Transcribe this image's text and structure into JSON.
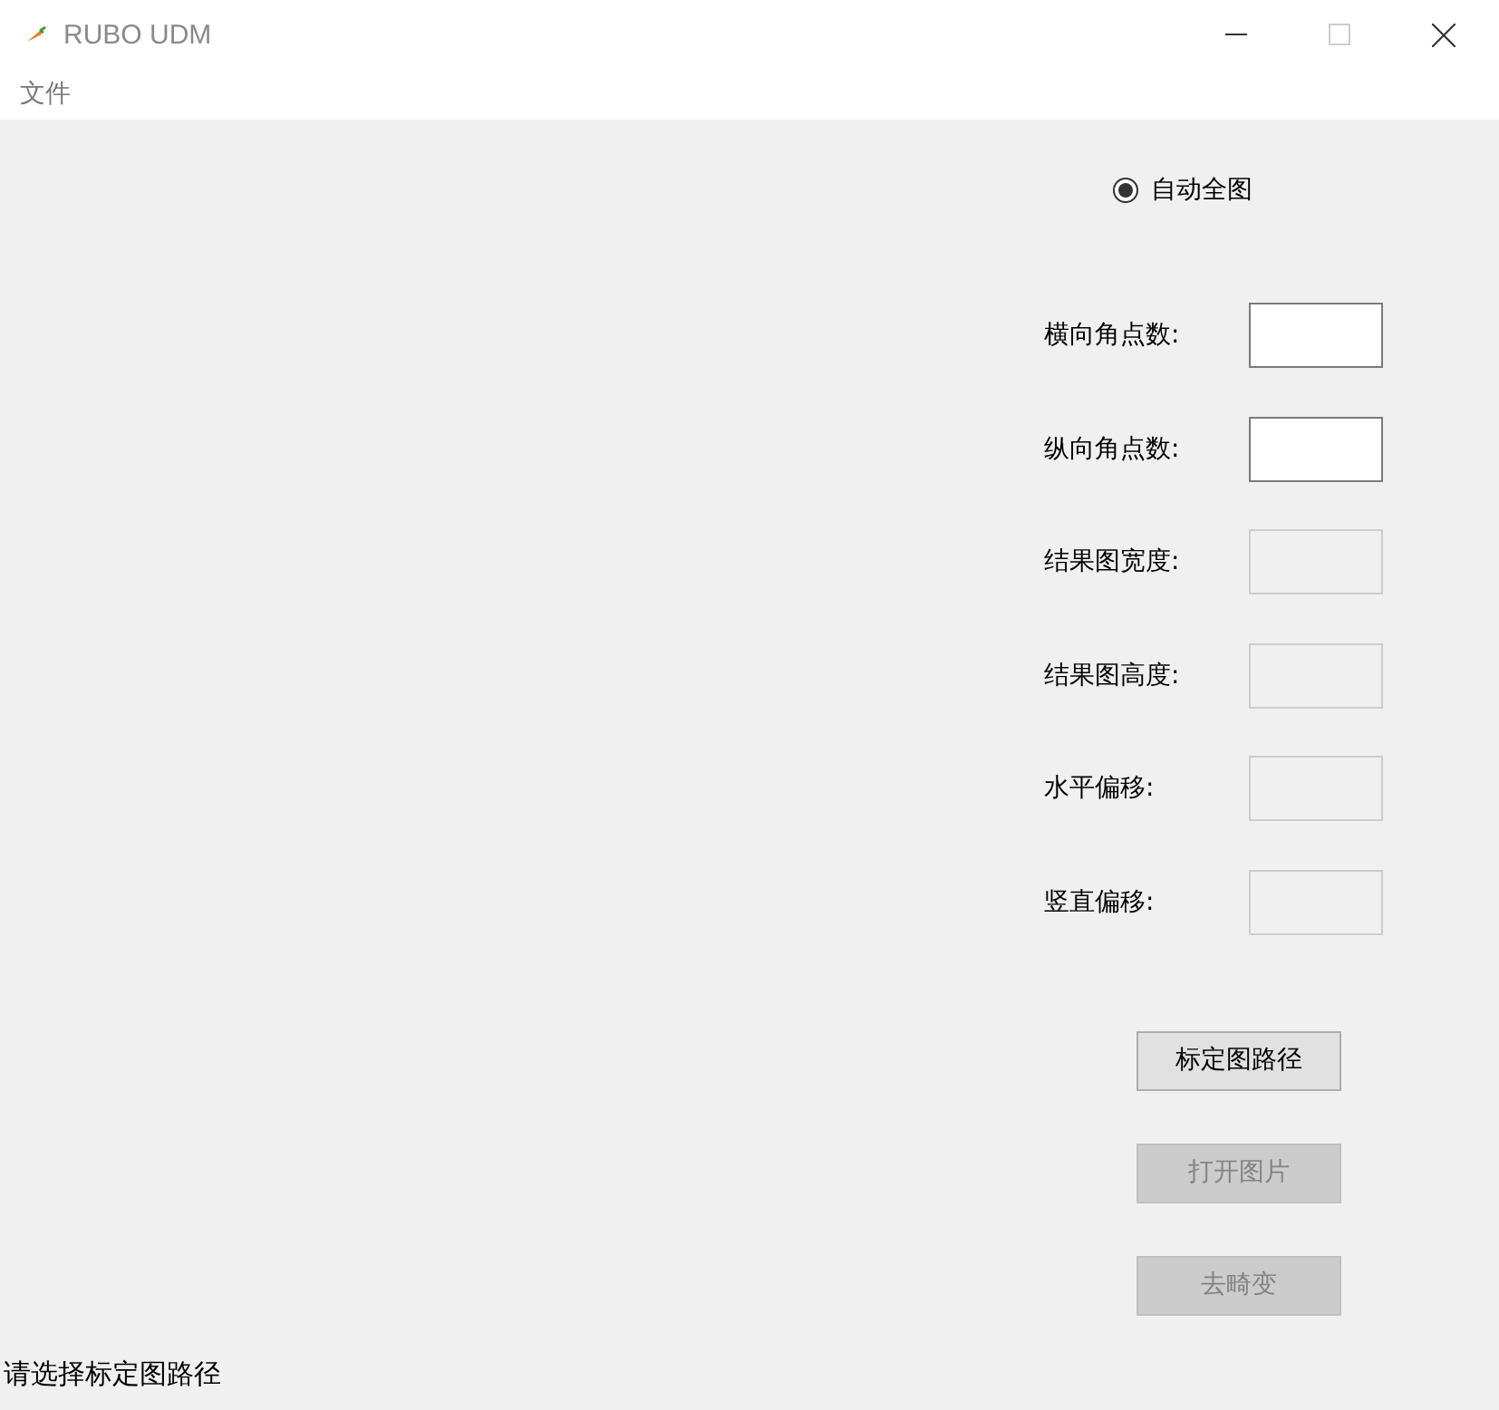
{
  "window": {
    "title": "RUBO UDM"
  },
  "menu": [
    {
      "label": "文件"
    }
  ],
  "radio": {
    "label": "自动全图",
    "selected": true
  },
  "fields": [
    {
      "label": "横向角点数:",
      "disabled": false
    },
    {
      "label": "纵向角点数:",
      "disabled": false
    },
    {
      "label": "结果图宽度:",
      "disabled": true
    },
    {
      "label": "结果图高度:",
      "disabled": true
    },
    {
      "label": "水平偏移:",
      "disabled": true
    },
    {
      "label": "竖直偏移:",
      "disabled": true
    }
  ],
  "buttons": [
    {
      "label": "标定图路径",
      "disabled": false
    },
    {
      "label": "打开图片",
      "disabled": true
    },
    {
      "label": "去畸变",
      "disabled": true
    }
  ],
  "status_bar": "请选择标定图路径"
}
